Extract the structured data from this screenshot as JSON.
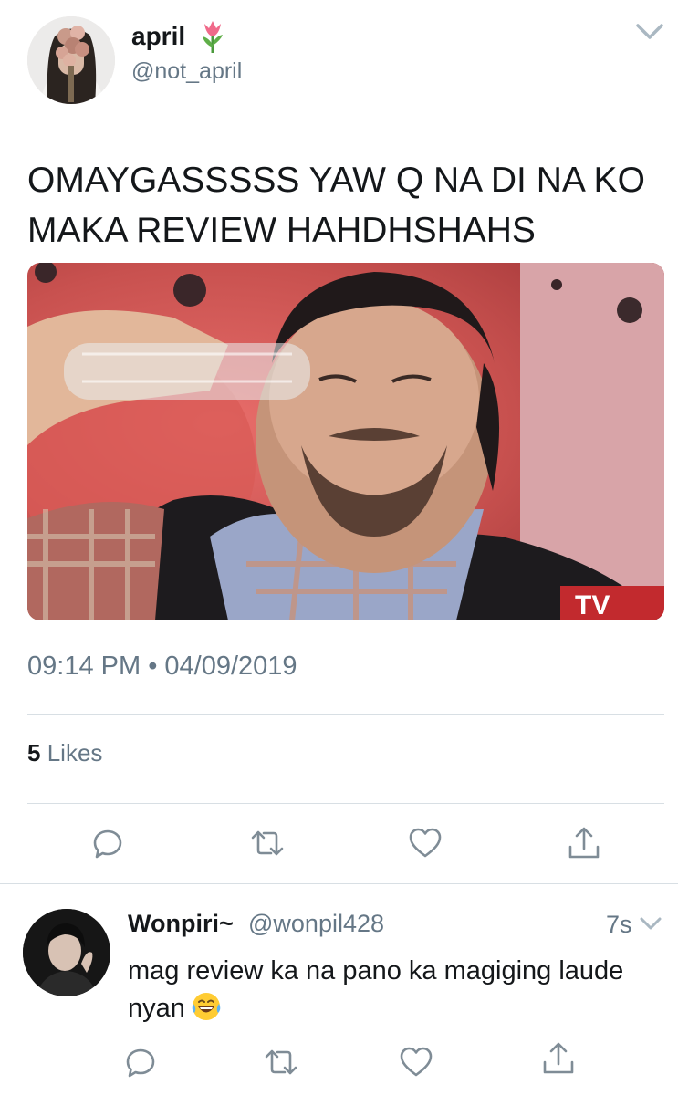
{
  "tweet": {
    "author_name": "april",
    "author_handle": "@not_april",
    "text": "OMAYGASSSSS YAW Q NA DI NA KO MAKA REVIEW HAHDHSHAHS",
    "time": "09:14 PM",
    "separator": "•",
    "date": "04/09/2019",
    "likes_count": "5",
    "likes_label": "Likes",
    "tv_logo_text": "TV"
  },
  "reply": {
    "author_name": "Wonpiri~",
    "author_handle": "@wonpil428",
    "time": "7s",
    "text": "mag review ka na pano ka magiging laude nyan"
  },
  "icons": {
    "header": [
      "tulip-emoji-icon",
      "chevron-down-icon"
    ],
    "actions": [
      "reply-icon",
      "retweet-icon",
      "like-icon",
      "share-icon"
    ],
    "reply_emoji": "laughing-tears-emoji-icon"
  },
  "colors": {
    "text": "#14171a",
    "secondary": "#657786",
    "divider": "#d8dfe4",
    "action_icon": "#7f8c96"
  }
}
